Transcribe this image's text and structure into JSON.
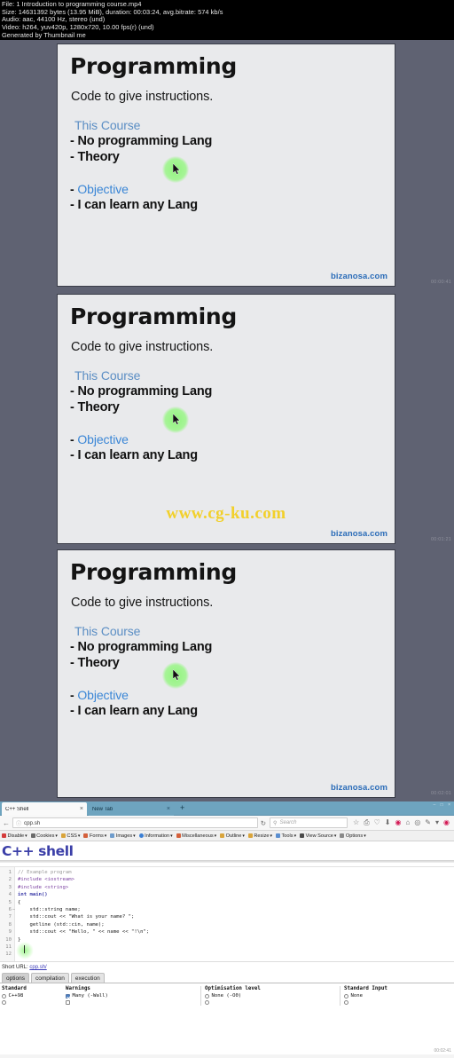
{
  "video_info": {
    "lines": [
      "File: 1 Introduction to programming course.mp4",
      "Size: 14631392 bytes (13.95 MiB), duration: 00:03:24, avg.bitrate: 574 kb/s",
      "Audio: aac, 44100 Hz, stereo (und)",
      "Video: h264, yuv420p, 1280x720, 10.00 fps(r) (und)",
      "Generated by Thumbnail me"
    ]
  },
  "slides": [
    {
      "title": "Programming",
      "subtitle": "Code to give instructions.",
      "section": "This Course",
      "bullets": [
        "- No programming Lang",
        "- Theory"
      ],
      "objective_dash": "-",
      "objective": "Objective",
      "objective_bullet": "- I can learn any Lang",
      "brand": "bizanosa.com",
      "watermark": "",
      "timestamp": "00:00:41"
    },
    {
      "title": "Programming",
      "subtitle": "Code to give instructions.",
      "section": "This Course",
      "bullets": [
        "- No programming Lang",
        "- Theory"
      ],
      "objective_dash": "-",
      "objective": "Objective",
      "objective_bullet": "- I can learn any Lang",
      "brand": "bizanosa.com",
      "watermark": "www.cg-ku.com",
      "timestamp": "00:01:21"
    },
    {
      "title": "Programming",
      "subtitle": "Code to give instructions.",
      "section": "This Course",
      "bullets": [
        "- No programming Lang",
        "- Theory"
      ],
      "objective_dash": "-",
      "objective": "Objective",
      "objective_bullet": "- I can learn any Lang",
      "brand": "bizanosa.com",
      "watermark": "",
      "timestamp": "00:02:01"
    }
  ],
  "browser": {
    "tabs": [
      {
        "label": "C++ Shell",
        "close": "×"
      },
      {
        "label": "New Tab",
        "close": "×"
      }
    ],
    "new_tab_plus": "+",
    "window_controls": "– □ ×",
    "back_arrow": "←",
    "url": "cpp.sh",
    "shield_icon": "ⓘ",
    "reload_icon": "↻",
    "search_placeholder": "Search",
    "search_icon": "⚲",
    "toolbar_icons": [
      "☆",
      "⎙",
      "♡",
      "⬇",
      "◉",
      "⌂",
      "◎",
      "✎",
      "▾",
      "◉"
    ]
  },
  "devtools": {
    "items": [
      {
        "label": "Disable",
        "color": "#d43b3b"
      },
      {
        "label": "Cookies",
        "color": "#6a6a6a"
      },
      {
        "label": "CSS",
        "color": "#d9a43b"
      },
      {
        "label": "Forms",
        "color": "#d4603b"
      },
      {
        "label": "Images",
        "color": "#6e9ccc"
      },
      {
        "label": "Information",
        "color": "#3b7fd4"
      },
      {
        "label": "Miscellaneous",
        "color": "#d4603b"
      },
      {
        "label": "Outline",
        "color": "#d9a43b"
      },
      {
        "label": "Resize",
        "color": "#d9a43b"
      },
      {
        "label": "Tools",
        "color": "#5a8ed0"
      },
      {
        "label": "View Source",
        "color": "#4a4a4a"
      },
      {
        "label": "Options",
        "color": "#8a8a8a"
      }
    ],
    "caret": "▾"
  },
  "cpp_shell": {
    "logo": "C++ shell",
    "line_numbers": [
      "1",
      "2",
      "3",
      "4",
      "5",
      "6",
      "7",
      "8",
      "9",
      "10",
      "11",
      "12"
    ],
    "code_lines": [
      "// Example program",
      "#include <iostream>",
      "#include <string>",
      "",
      "int main()",
      "{",
      "    std::string name;",
      "    std::cout << \"What is your name? \";",
      "    getline (std::cin, name);",
      "    std::cout << \"Hello, \" << name << \"!\\n\";",
      "}",
      ""
    ],
    "fold_marker": "–",
    "short_url_label": "Short URL:",
    "short_url": "cpp.sh/",
    "subtabs": [
      "options",
      "compilation",
      "execution"
    ],
    "active_subtab": "options",
    "options": [
      {
        "heading": "Standard",
        "rows": [
          {
            "label": "C++98",
            "type": "radio",
            "checked": false
          }
        ]
      },
      {
        "heading": "Warnings",
        "rows": [
          {
            "label": "Many (-Wall)",
            "type": "checkbox",
            "checked": true
          }
        ]
      },
      {
        "heading": "Optimisation level",
        "rows": [
          {
            "label": "None (-O0)",
            "type": "radio",
            "checked": false
          }
        ]
      },
      {
        "heading": "Standard Input",
        "rows": [
          {
            "label": "None",
            "type": "radio",
            "checked": false
          }
        ]
      }
    ],
    "timestamp": "00:02:41"
  }
}
